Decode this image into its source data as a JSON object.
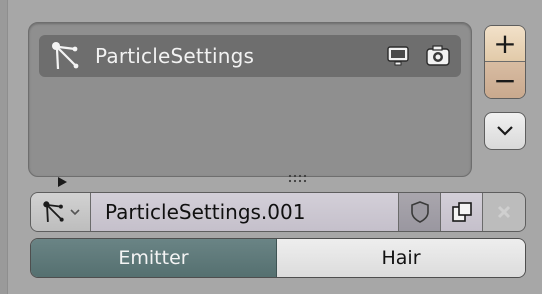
{
  "particle_list": {
    "items": [
      {
        "label": "ParticleSettings",
        "icon": "particles-icon"
      }
    ],
    "row_icons": [
      "monitor-icon",
      "camera-icon"
    ],
    "expand_icon": "triangle-right-icon",
    "resize_icon": "grip-dots-icon"
  },
  "side_buttons": {
    "add_label": "+",
    "remove_label": "−",
    "menu_icon": "chevron-down-icon"
  },
  "id_selector": {
    "browse_icon": "particles-icon",
    "name": "ParticleSettings.001",
    "fake_user_icon": "shield-icon",
    "copy_icon": "duplicate-icon",
    "unlink_icon": "x-icon"
  },
  "type_toggle": {
    "options": [
      "Emitter",
      "Hair"
    ],
    "selected": "Emitter"
  },
  "colors": {
    "panel_bg": "#a7a7a7",
    "list_bg": "#8f8f8f",
    "selected_row": "#6e6e6e",
    "active_toggle": "#5f7b7b",
    "add_remove_bg": "#e2caa9"
  }
}
